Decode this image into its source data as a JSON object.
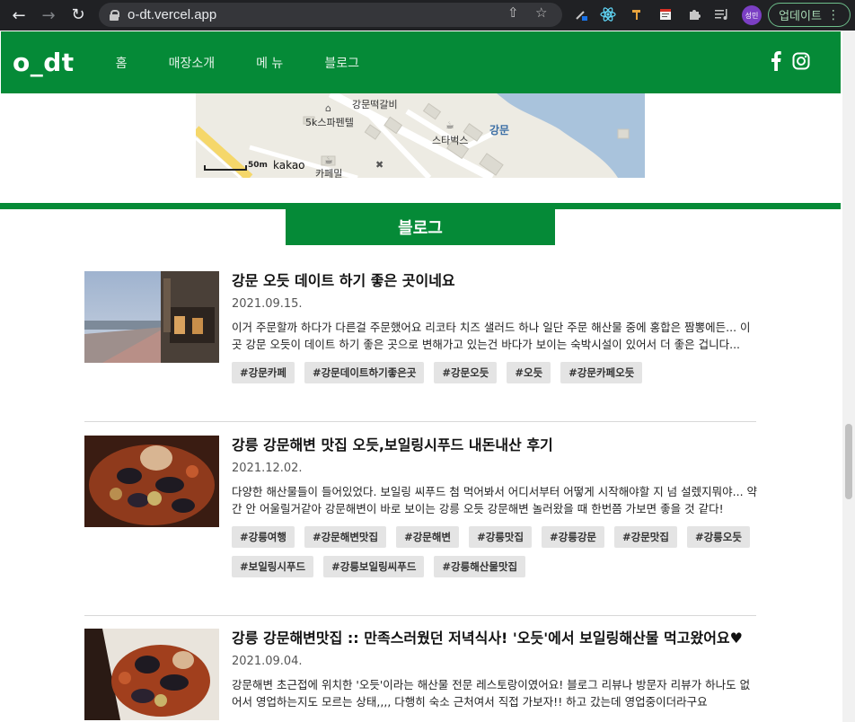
{
  "browser": {
    "url": "o-dt.vercel.app",
    "profile": "성민",
    "update_label": "업데이트"
  },
  "header": {
    "logo": "o_dt",
    "menu": [
      "홈",
      "매장소개",
      "메 뉴",
      "블로그"
    ]
  },
  "map": {
    "labels": {
      "galbi": "강문떡갈비",
      "pension": "5k스파펜텔",
      "starbucks": "스타벅스",
      "gangmun": "강문",
      "cafe": "카페밀",
      "scale": "50m",
      "provider": "kakao"
    }
  },
  "blog": {
    "section_title": "블로그",
    "posts": [
      {
        "title": "강문 오듯 데이트 하기 좋은 곳이네요",
        "date": "2021.09.15.",
        "excerpt": "이거 주문할까 하다가 다른걸 주문했어요 리코타 치즈 샐러드 하나 일단 주문 해산물 중에 홍합은 짬뽕에든... 이곳 강문 오듯이 데이트 하기 좋은 곳으로 변해가고 있는건 바다가 보이는 숙박시설이 있어서 더 좋은 겁니다...",
        "tags": [
          "#강문카페",
          "#강문데이트하기좋은곳",
          "#강문오듯",
          "#오듯",
          "#강문카페오듯"
        ]
      },
      {
        "title": "강릉 강문해변 맛집 오듯,보일링시푸드 내돈내산 후기",
        "date": "2021.12.02.",
        "excerpt": "다양한 해산물들이 들어있었다. 보일링 씨푸드 첨 먹어봐서 어디서부터 어떻게 시작해야할 지 넘 설렜지뭐야... 약간 안 어울릴거같아 강문해변이 바로 보이는 강릉 오듯 강문해변 놀러왔을 때 한번쯤 가보면 좋을 것 같다!",
        "tags": [
          "#강릉여행",
          "#강문해변맛집",
          "#강문해변",
          "#강릉맛집",
          "#강릉강문",
          "#강문맛집",
          "#강릉오듯",
          "#보일링시푸드",
          "#강릉보일링씨푸드",
          "#강릉해산물맛집"
        ]
      },
      {
        "title": "강릉 강문해변맛집 :: 만족스러웠던 저녁식사! '오듯'에서 보일링해산물 먹고왔어요♥",
        "date": "2021.09.04.",
        "excerpt": "강문해변 초근접에 위치한 '오듯'이라는 해산물 전문 레스토랑이였어요! 블로그 리뷰나 방문자 리뷰가 하나도 없어서 영업하는지도 모르는 상태,,,, 다행히 숙소 근처여서 직접 가보자!! 하고 갔는데 영업중이더라구요",
        "tags": []
      }
    ]
  },
  "colors": {
    "brand_green": "#058a37",
    "chrome_dark": "#202124"
  }
}
